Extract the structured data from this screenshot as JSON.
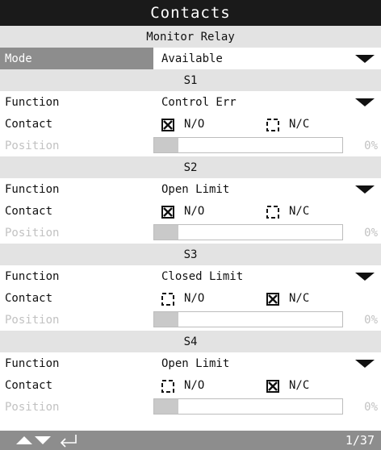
{
  "title": "Contacts",
  "header": {
    "section": "Monitor Relay"
  },
  "mode": {
    "label": "Mode",
    "value": "Available"
  },
  "relays": [
    {
      "name": "S1",
      "function_label": "Function",
      "function_value": "Control Err",
      "contact_label": "Contact",
      "no_label": "N/O",
      "nc_label": "N/C",
      "no_checked": true,
      "nc_checked": false,
      "position_label": "Position",
      "position_pct": "0%",
      "position_fraction": 0.0
    },
    {
      "name": "S2",
      "function_label": "Function",
      "function_value": "Open Limit",
      "contact_label": "Contact",
      "no_label": "N/O",
      "nc_label": "N/C",
      "no_checked": true,
      "nc_checked": false,
      "position_label": "Position",
      "position_pct": "0%",
      "position_fraction": 0.0
    },
    {
      "name": "S3",
      "function_label": "Function",
      "function_value": "Closed Limit",
      "contact_label": "Contact",
      "no_label": "N/O",
      "nc_label": "N/C",
      "no_checked": false,
      "nc_checked": true,
      "position_label": "Position",
      "position_pct": "0%",
      "position_fraction": 0.0
    },
    {
      "name": "S4",
      "function_label": "Function",
      "function_value": "Open Limit",
      "contact_label": "Contact",
      "no_label": "N/O",
      "nc_label": "N/C",
      "no_checked": false,
      "nc_checked": true,
      "position_label": "Position",
      "position_pct": "0%",
      "position_fraction": 0.0
    }
  ],
  "footer": {
    "page": "1/37",
    "icons": [
      "up-arrow-icon",
      "down-arrow-icon",
      "enter-icon"
    ]
  },
  "colors": {
    "title_bg": "#1a1a1a",
    "header_bg": "#e3e3e3",
    "mode_label_bg": "#8d8d8d",
    "footer_bg": "#8d8d8d"
  }
}
